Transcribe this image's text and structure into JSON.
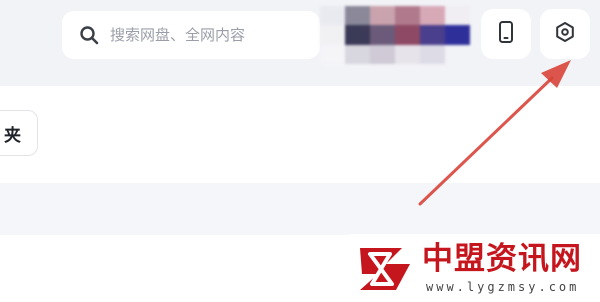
{
  "search": {
    "placeholder": "搜索网盘、全网内容"
  },
  "toolbar": {
    "phone_icon": "phone-icon",
    "settings_icon": "settings-icon"
  },
  "content": {
    "folder_button_label": "夹"
  },
  "annotation": {
    "arrow_color": "#d9443a"
  },
  "watermark": {
    "title": "中盟资讯网",
    "url": "www.lygzmsy.com"
  },
  "colors": {
    "topbar_bg": "#f2f3f7",
    "brand_red": "#c5161d"
  }
}
